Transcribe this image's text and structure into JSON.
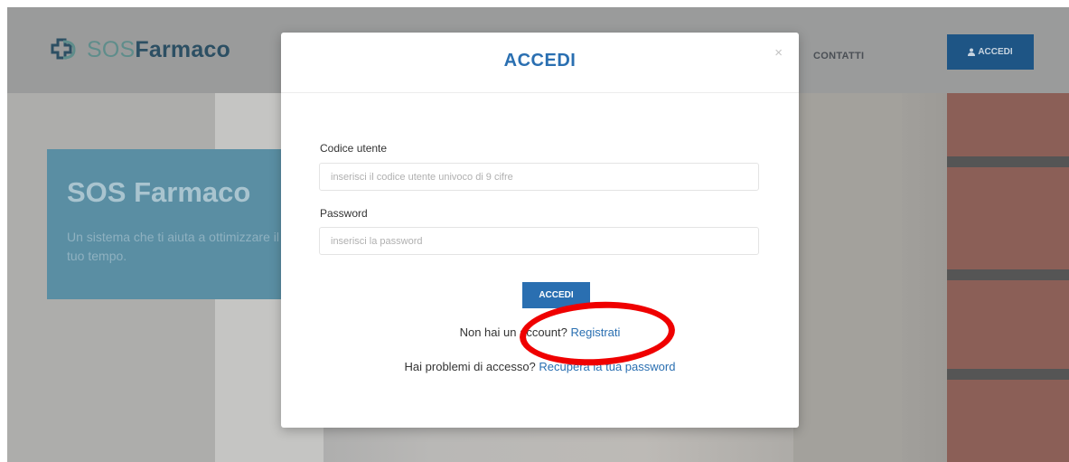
{
  "header": {
    "logo_sos": "SOS",
    "logo_farmaco": "Farmaco",
    "nav_contatti": "CONTATTI",
    "nav_accedi": "ACCEDI"
  },
  "hero": {
    "title": "SOS Farmaco",
    "subtitle": "Un sistema che ti aiuta a ottimizzare il tuo tempo."
  },
  "modal": {
    "title": "ACCEDI",
    "close": "×",
    "user_label": "Codice utente",
    "user_placeholder": "inserisci il codice utente univoco di 9 cifre",
    "password_label": "Password",
    "password_placeholder": "inserisci la password",
    "submit_label": "ACCEDI",
    "no_account_text": "Non hai un account?",
    "register_link": "Registrati",
    "problems_text": "Hai problemi di accesso?",
    "recover_link": "Recupera la tua password"
  },
  "colors": {
    "brand_blue": "#2a6fb1",
    "nav_button": "#1e5585",
    "annotation_red": "#ef0000"
  }
}
